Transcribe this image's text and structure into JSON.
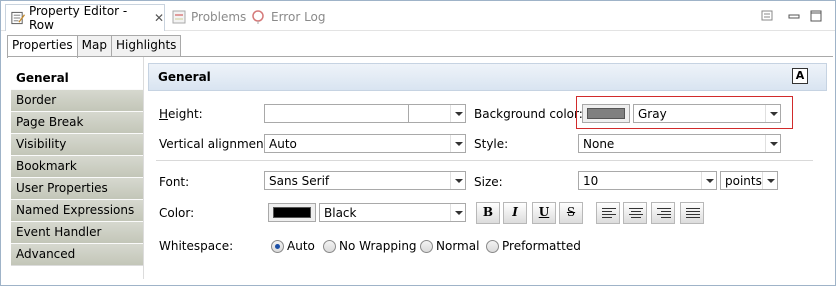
{
  "view_tabs": [
    {
      "label": "Property Editor - Row",
      "icon": "property-editor-icon",
      "active": true
    },
    {
      "label": "Problems",
      "icon": "problems-icon",
      "active": false
    },
    {
      "label": "Error Log",
      "icon": "error-log-icon",
      "active": false
    }
  ],
  "view_buttons": [
    "view-menu-icon",
    "minimize-icon",
    "maximize-icon"
  ],
  "sub_tabs": [
    {
      "label": "Properties",
      "active": true
    },
    {
      "label": "Map",
      "active": false
    },
    {
      "label": "Highlights",
      "active": false
    }
  ],
  "categories": [
    {
      "label": "General",
      "active": true
    },
    {
      "label": "Border"
    },
    {
      "label": "Page Break"
    },
    {
      "label": "Visibility"
    },
    {
      "label": "Bookmark"
    },
    {
      "label": "User Properties"
    },
    {
      "label": "Named Expressions"
    },
    {
      "label": "Event Handler"
    },
    {
      "label": "Advanced"
    }
  ],
  "section": {
    "title": "General",
    "icon": "reset-font-icon"
  },
  "form": {
    "height_label": "Height:",
    "height_value": "",
    "height_unit": "",
    "background_color_label": "Background color:",
    "background_color_value": "Gray",
    "background_color_swatch": "#808080",
    "vertical_alignment_label": "Vertical alignment:",
    "vertical_alignment_value": "Auto",
    "style_label": "Style:",
    "style_value": "None",
    "font_label": "Font:",
    "font_value": "Sans Serif",
    "size_label": "Size:",
    "size_value": "10",
    "size_unit": "points",
    "color_label": "Color:",
    "color_value": "Black",
    "color_swatch": "#000000",
    "whitespace_label": "Whitespace:",
    "whitespace_options": [
      "Auto",
      "No Wrapping",
      "Normal",
      "Preformatted"
    ],
    "whitespace_selected": "Auto"
  },
  "format_buttons": {
    "bold": "B",
    "italic": "I",
    "underline": "U",
    "strikethrough": "S"
  }
}
